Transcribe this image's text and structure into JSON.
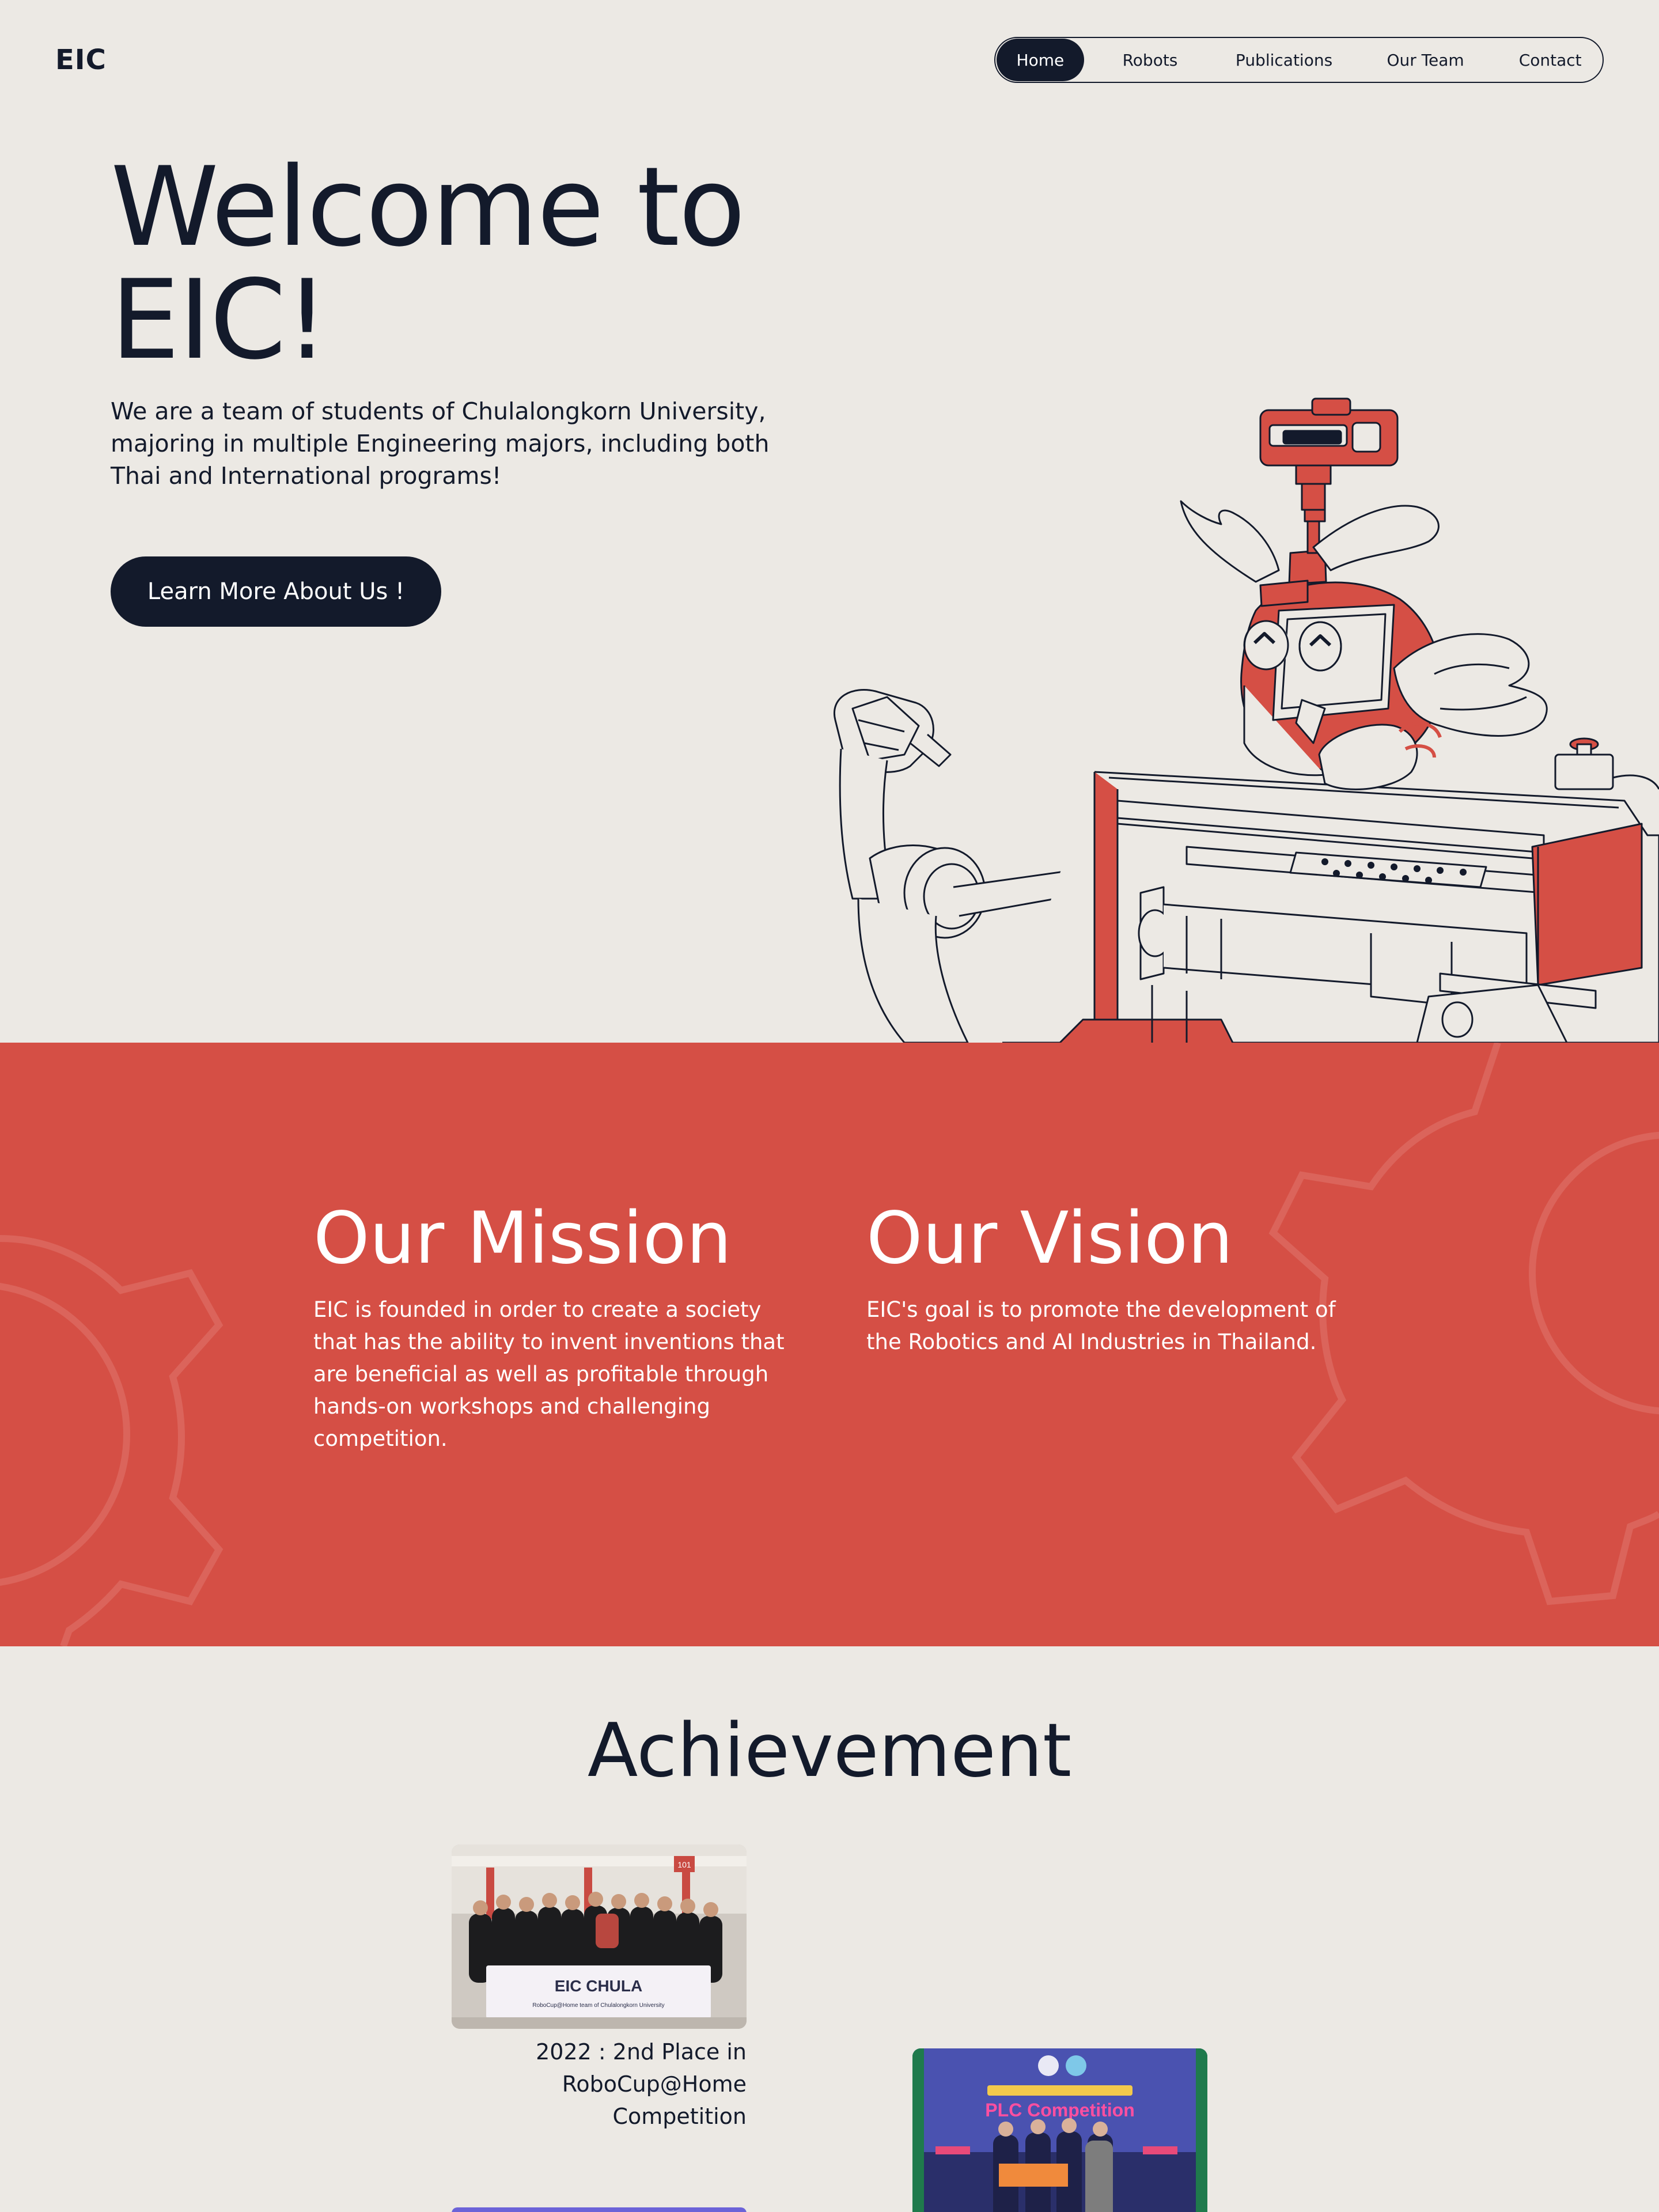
{
  "header": {
    "logo": "EIC",
    "nav": [
      {
        "label": "Home",
        "active": true
      },
      {
        "label": "Robots",
        "active": false
      },
      {
        "label": "Publications",
        "active": false
      },
      {
        "label": "Our Team",
        "active": false
      },
      {
        "label": "Contact",
        "active": false
      }
    ]
  },
  "hero": {
    "title_line1": "Welcome to",
    "title_line2": "EIC!",
    "description": "We are a team of students of Chulalongkorn University, majoring in multiple Engineering majors, including both Thai and International programs!",
    "cta_label": "Learn More About Us !"
  },
  "mission": {
    "title": "Our Mission",
    "text": "EIC is founded in order to create a society that has the ability to invent inventions that are beneficial as well as profitable through hands-on workshops and challenging competition."
  },
  "vision": {
    "title": "Our Vision",
    "text": "EIC's goal is to promote the development of the Robotics and AI Industries in Thailand."
  },
  "achievement": {
    "title": "Achievement",
    "items": [
      {
        "caption": "2022 : 2nd Place in RoboCup@Home Competition",
        "banner_title": "EIC CHULA",
        "banner_subtitle": "RoboCup@Home team of Chulalongkorn University",
        "booth_number": "101"
      },
      {
        "caption": "",
        "banner_title": "PLC Competition"
      }
    ]
  },
  "colors": {
    "background": "#ECE9E4",
    "navy": "#131A2B",
    "red": "#D54F45",
    "white": "#FFFFFF"
  }
}
